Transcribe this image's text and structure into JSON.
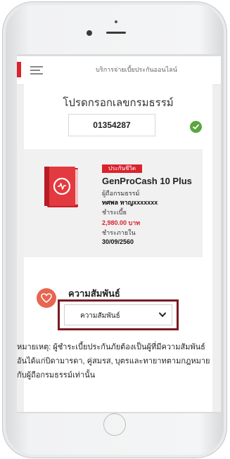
{
  "header": {
    "title": "บริการจ่ายเบี้ยประกันออนไลน์",
    "icons": {
      "menu": "hamburger-menu-icon"
    }
  },
  "form": {
    "prompt": "โปรดกรอกเลขกรมธรรม์",
    "policy_number": "01354287",
    "status_icon": "check-circle-icon"
  },
  "policy": {
    "badge": "ประกันชีวิต",
    "plan": "GenProCash 10 Plus",
    "holder_label": "ผู้ถือกรมธรรม์",
    "holder_name": "ทศพล หาญxxxxxxx",
    "premium_label": "ชำระเบี้ย",
    "premium_amount": "2,980.00 บาท",
    "due_label": "ชำระภายใน",
    "due_date": "30/09/2560",
    "icon": "insurance-book-icon"
  },
  "relationship": {
    "title": "ความสัมพันธ์",
    "select_value": "ความสัมพันธ์",
    "icon": "heart-icon"
  },
  "note": "หมายเหตุ: ผู้ชำระเบี้ยประกันภัยต้องเป็นผู้ที่มีความสัมพันธ์อันได้แก่บิดามารดา, คู่สมรส, บุตรและทายาทตามกฎหมายกับผู้ถือกรมธรรม์เท่านั้น",
  "colors": {
    "brand_red": "#d9232d",
    "selection_border": "#7c1a23",
    "success_green": "#5aa640",
    "heart_bg": "#e8654f"
  }
}
